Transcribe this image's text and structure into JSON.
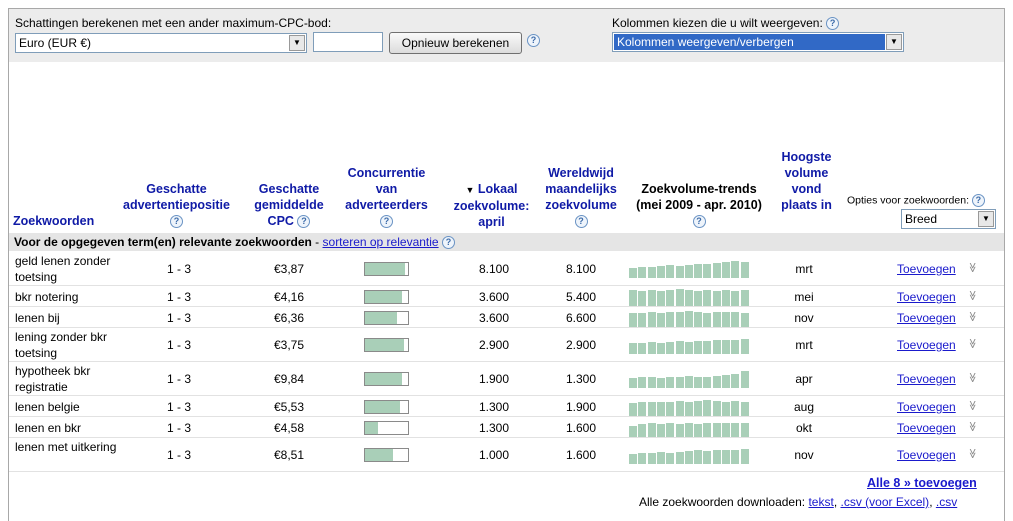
{
  "top": {
    "estimate_label": "Schattingen berekenen met een ander maximum-CPC-bod:",
    "currency_value": "Euro (EUR €)",
    "cpc_input_value": "",
    "recalc_button": "Opnieuw berekenen",
    "columns_label": "Kolommen kiezen die u wilt weergeven:",
    "columns_value": "Kolommen weergeven/verbergen"
  },
  "headers": {
    "keywords": "Zoekwoorden",
    "position": "Geschatte advertentiepositie",
    "cpc": "Geschatte gemiddelde CPC",
    "competition": "Concurrentie van adverteerders",
    "local_arrow": "▼",
    "local": "Lokaal zoekvolume: april",
    "global": "Wereldwijd maandelijks zoekvolume",
    "trends": "Zoekvolume-trends (mei 2009 - apr. 2010)",
    "peak": "Hoogste volume vond plaats in",
    "options_label": "Opties voor zoekwoorden:",
    "match_value": "Breed"
  },
  "section": {
    "title": "Voor de opgegeven term(en) relevante zoekwoorden",
    "separator": " - ",
    "sort_link": "sorteren op relevantie"
  },
  "rows": [
    {
      "keyword": "geld lenen zonder toetsing",
      "position": "1 - 3",
      "cpc": "€3,87",
      "competition": 0.93,
      "local": "8.100",
      "global": "8.100",
      "trend": [
        0.55,
        0.6,
        0.6,
        0.65,
        0.7,
        0.65,
        0.7,
        0.75,
        0.8,
        0.85,
        0.9,
        0.95,
        0.9
      ],
      "peak": "mrt",
      "add": "Toevoegen"
    },
    {
      "keyword": "bkr notering",
      "position": "1 - 3",
      "cpc": "€4,16",
      "competition": 0.85,
      "local": "3.600",
      "global": "5.400",
      "trend": [
        0.9,
        0.85,
        0.9,
        0.85,
        0.9,
        0.95,
        0.9,
        0.85,
        0.9,
        0.85,
        0.9,
        0.85,
        0.9
      ],
      "peak": "mei",
      "add": "Toevoegen"
    },
    {
      "keyword": "lenen bij",
      "position": "1 - 3",
      "cpc": "€6,36",
      "competition": 0.75,
      "local": "3.600",
      "global": "6.600",
      "trend": [
        0.8,
        0.8,
        0.85,
        0.8,
        0.85,
        0.85,
        0.9,
        0.85,
        0.8,
        0.85,
        0.85,
        0.85,
        0.8
      ],
      "peak": "nov",
      "add": "Toevoegen"
    },
    {
      "keyword": "lening zonder bkr toetsing",
      "position": "1 - 3",
      "cpc": "€3,75",
      "competition": 0.9,
      "local": "2.900",
      "global": "2.900",
      "trend": [
        0.6,
        0.6,
        0.65,
        0.6,
        0.65,
        0.7,
        0.65,
        0.7,
        0.7,
        0.75,
        0.75,
        0.8,
        0.85
      ],
      "peak": "mrt",
      "add": "Toevoegen"
    },
    {
      "keyword": "hypotheek bkr registratie",
      "position": "1 - 3",
      "cpc": "€9,84",
      "competition": 0.87,
      "local": "1.900",
      "global": "1.300",
      "trend": [
        0.55,
        0.6,
        0.6,
        0.55,
        0.6,
        0.6,
        0.65,
        0.6,
        0.6,
        0.65,
        0.7,
        0.8,
        0.95
      ],
      "peak": "apr",
      "add": "Toevoegen"
    },
    {
      "keyword": "lenen belgie",
      "position": "1 - 3",
      "cpc": "€5,53",
      "competition": 0.82,
      "local": "1.300",
      "global": "1.900",
      "trend": [
        0.7,
        0.75,
        0.8,
        0.75,
        0.8,
        0.85,
        0.8,
        0.85,
        0.9,
        0.85,
        0.8,
        0.85,
        0.8
      ],
      "peak": "aug",
      "add": "Toevoegen"
    },
    {
      "keyword": "lenen en bkr",
      "position": "1 - 3",
      "cpc": "€4,58",
      "competition": 0.3,
      "local": "1.300",
      "global": "1.600",
      "trend": [
        0.6,
        0.7,
        0.75,
        0.7,
        0.8,
        0.7,
        0.75,
        0.7,
        0.8,
        0.75,
        0.8,
        0.75,
        0.8
      ],
      "peak": "okt",
      "add": "Toevoegen"
    },
    {
      "keyword": "lenen met uitkering",
      "position": "1 - 3",
      "cpc": "€8,51",
      "competition": 0.65,
      "local": "1.000",
      "global": "1.600",
      "trend": [
        0.55,
        0.6,
        0.6,
        0.65,
        0.6,
        0.65,
        0.7,
        0.75,
        0.7,
        0.75,
        0.8,
        0.8,
        0.85
      ],
      "peak": "nov",
      "add": "Toevoegen"
    }
  ],
  "footer": {
    "add_all": "Alle 8 » toevoegen",
    "download_label": "Alle zoekwoorden downloaden:",
    "link_text": "tekst",
    "link_csv_excel": ".csv (voor Excel)",
    "link_csv": ".csv",
    "sep1": ",",
    "sep2": ","
  },
  "colors": {
    "bar_fill": "#a9cfb8",
    "link": "#1a1acc",
    "header_text": "#0f1aa6"
  }
}
